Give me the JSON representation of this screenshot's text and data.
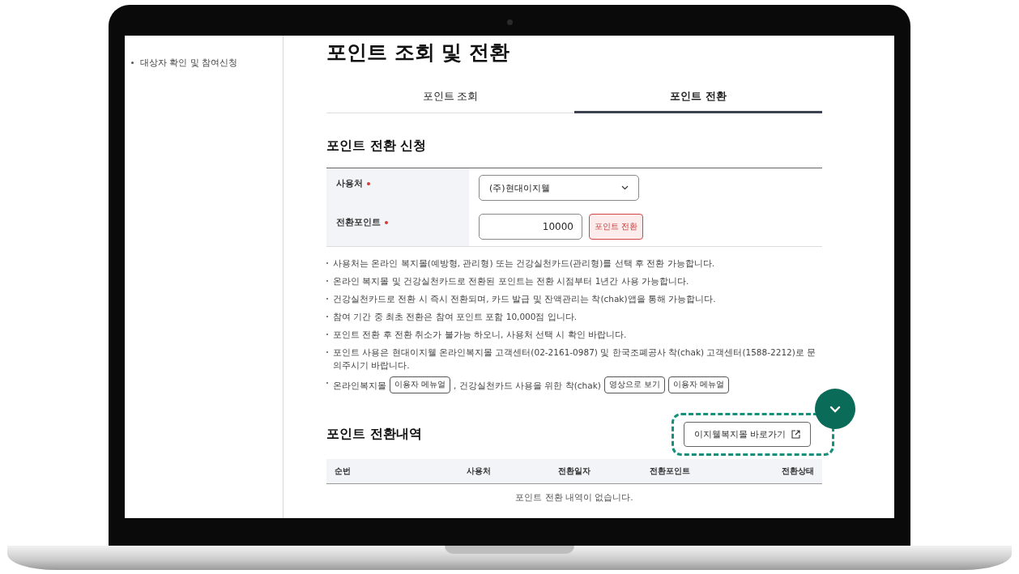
{
  "sidebar": {
    "items": [
      {
        "label": "대상자 확인 및 참여신청"
      }
    ]
  },
  "page_title": "포인트 조회 및 전환",
  "tabs": [
    {
      "label": "포인트 조회",
      "selected": false
    },
    {
      "label": "포인트 전환",
      "selected": true
    }
  ],
  "form": {
    "title": "포인트 전환 신청",
    "fields": [
      {
        "kind": "select",
        "label": "사용처",
        "required": true,
        "value": "(주)현대이지웰"
      },
      {
        "kind": "input",
        "label": "전환포인트",
        "required": true,
        "value": "10000",
        "button": "포인트 전환"
      }
    ]
  },
  "notes": [
    {
      "kind": "text",
      "text": "사용처는 온라인 복지몰(예방형, 관리형) 또는 건강실천카드(관리형)를 선택 후 전환 가능합니다."
    },
    {
      "kind": "text",
      "text": "온라인 복지몰 및 건강실천카드로 전환된 포인트는 전환 시점부터 1년간 사용 가능합니다."
    },
    {
      "kind": "text",
      "text": "건강실천카드로 전환 시 즉시 전환되며, 카드 발급 및 잔액관리는 착(chak)앱을 통해 가능합니다."
    },
    {
      "kind": "text",
      "text": "참여 기간 중 최초 전환은 참여 포인트 포함 10,000점 입니다."
    },
    {
      "kind": "text",
      "text": "포인트 전환 후 전환 취소가 불가능 하오니, 사용처 선택 시 확인 바랍니다."
    },
    {
      "kind": "text",
      "text": "포인트 사용은 현대이지웰 온라인복지몰 고객센터(02-2161-0987) 및 한국조폐공사 착(chak) 고객센터(1588-2212)로 문의주시기 바랍니다."
    },
    {
      "kind": "links",
      "parts": [
        {
          "kind": "text",
          "text": "온라인복지몰"
        },
        {
          "kind": "button",
          "text": "이용자 메뉴얼"
        },
        {
          "kind": "text",
          "text": ", 건강실천카드 사용을 위한 착(chak)"
        },
        {
          "kind": "button",
          "text": "영상으로 보기"
        },
        {
          "kind": "button",
          "text": "이용자 메뉴얼"
        }
      ]
    }
  ],
  "history": {
    "title": "포인트 전환내역",
    "link_button": "이지웰복지몰 바로가기",
    "highlighted": true,
    "columns": [
      "순번",
      "사용처",
      "전환일자",
      "전환포인트",
      "전환상태"
    ],
    "empty_message": "포인트 전환 내역이 없습니다."
  }
}
